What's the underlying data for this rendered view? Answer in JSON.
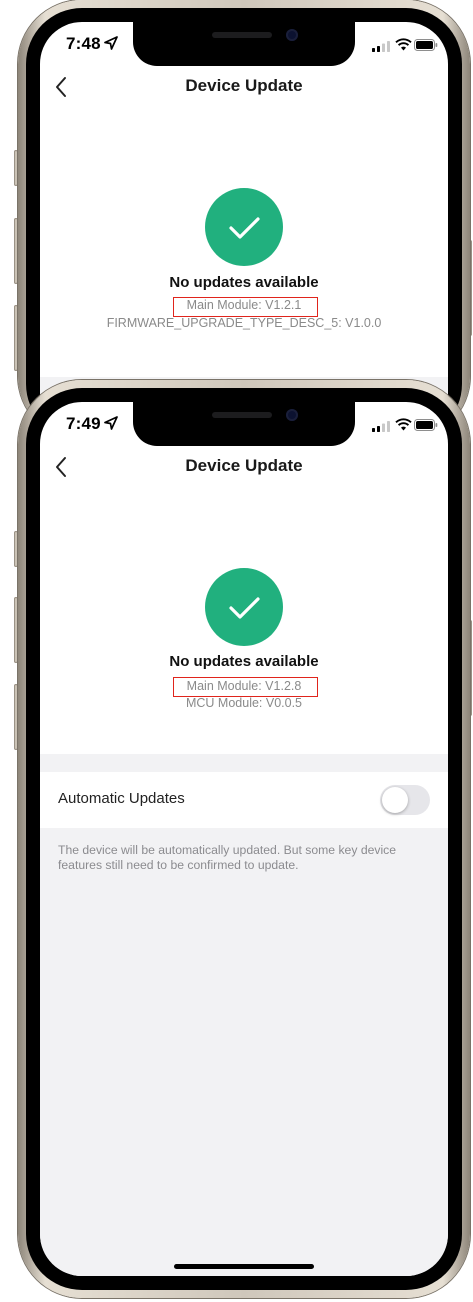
{
  "phone1": {
    "time": "7:48",
    "title": "Device Update",
    "headline": "No updates available",
    "main_module": "Main Module: V1.2.1",
    "secondary_module": "FIRMWARE_UPGRADE_TYPE_DESC_5: V1.0.0"
  },
  "phone2": {
    "time": "7:49",
    "title": "Device Update",
    "headline": "No updates available",
    "main_module": "Main Module: V1.2.8",
    "secondary_module": "MCU Module: V0.0.5",
    "auto_updates_label": "Automatic Updates",
    "auto_updates_enabled": false,
    "hint": "The device will be automatically updated. But some key device features still need to be confirmed to update."
  },
  "colors": {
    "success_green": "#21b07e",
    "highlight_red": "#e0241c",
    "muted_text": "#8a8a8a"
  },
  "icons": [
    "back-chevron-icon",
    "location-arrow-icon",
    "signal-icon",
    "wifi-icon",
    "battery-icon",
    "checkmark-icon"
  ]
}
